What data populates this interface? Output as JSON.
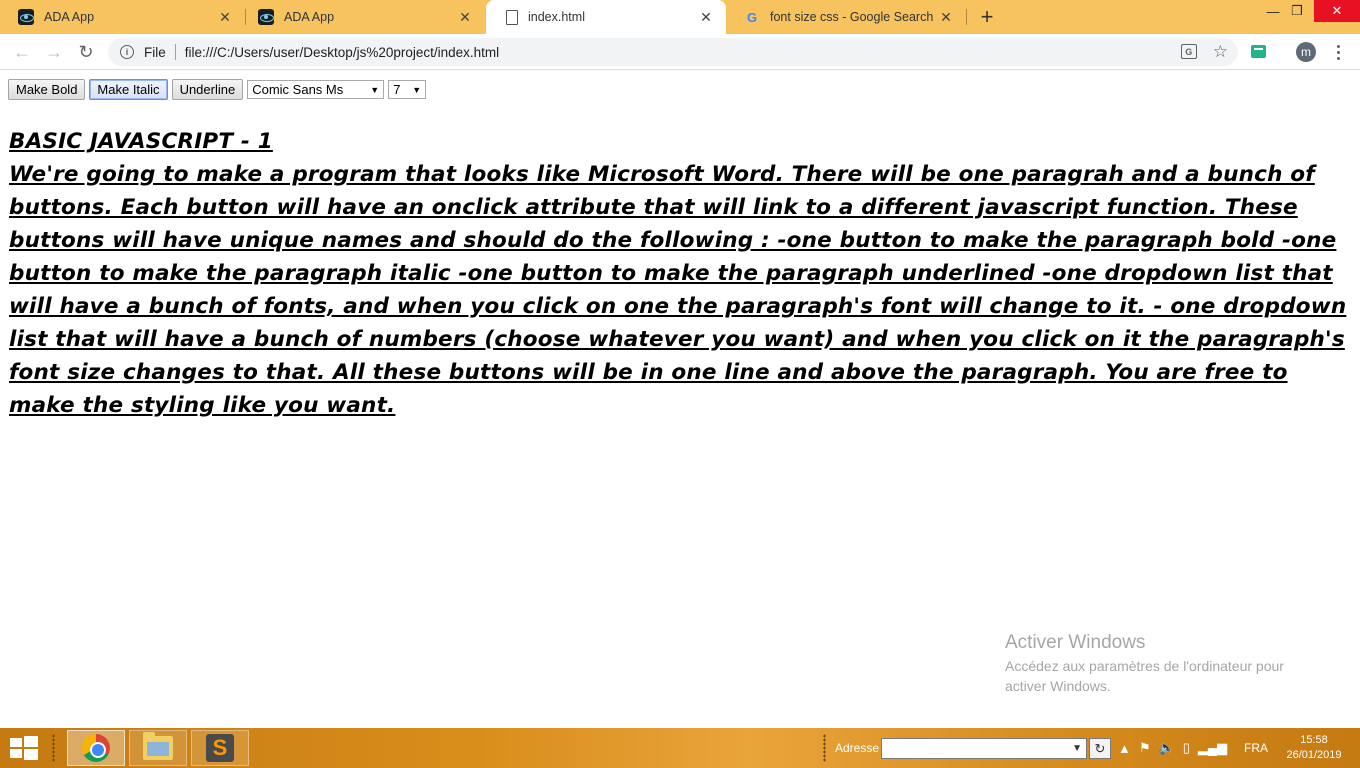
{
  "browser": {
    "tabs": [
      {
        "title": "ADA App",
        "icon": "react-icon",
        "active": false
      },
      {
        "title": "ADA App",
        "icon": "react-icon",
        "active": false
      },
      {
        "title": "index.html",
        "icon": "document-icon",
        "active": true
      },
      {
        "title": "font size css - Google Search",
        "icon": "google-icon",
        "active": false
      }
    ],
    "address_scheme": "File",
    "url": "file:///C:/Users/user/Desktop/js%20project/index.html",
    "profile_initial": "m"
  },
  "page": {
    "buttons": {
      "bold": "Make Bold",
      "italic": "Make Italic",
      "underline": "Underline"
    },
    "font_select": {
      "selected": "Comic Sans Ms"
    },
    "size_select": {
      "selected": "7"
    },
    "heading": "BASIC JAVASCRIPT - 1",
    "paragraph": "We're going to make a program that looks like Microsoft Word. There will be one paragrah and a bunch of buttons. Each button will have an onclick attribute that will link to a different javascript function. These buttons will have unique names and should do the following : -one button to make the paragraph bold -one button to make the paragraph italic -one button to make the paragraph underlined -one dropdown list that will have a bunch of fonts, and when you click on one the paragraph's font will change to it. - one dropdown list that will have a bunch of numbers (choose whatever you want) and when you click on it the paragraph's font size changes to that. All these buttons will be in one line and above the paragraph. You are free to make the styling like you want."
  },
  "watermark": {
    "title": "Activer Windows",
    "line1": "Accédez aux paramètres de l'ordinateur pour",
    "line2": "activer Windows."
  },
  "taskbar": {
    "address_label": "Adresse",
    "language": "FRA",
    "time": "15:58",
    "date": "26/01/2019"
  },
  "colors": {
    "tabstrip": "#f6c35f",
    "taskbar": "#d98d1b",
    "close_button": "#e81123"
  }
}
